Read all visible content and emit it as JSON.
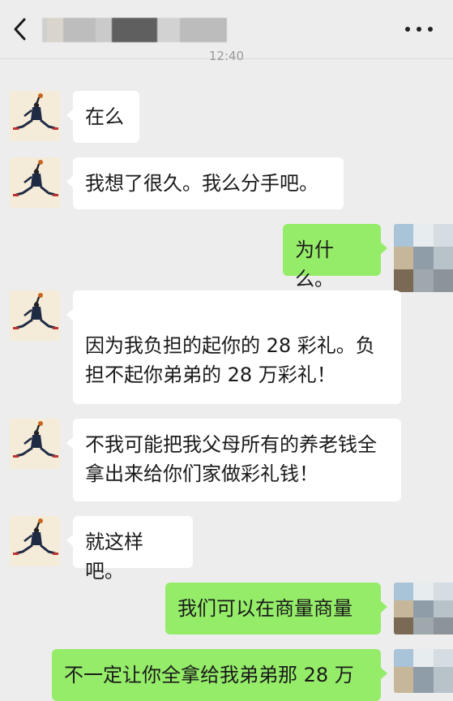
{
  "header": {
    "back_icon": "chevron-left-icon",
    "more_icon": "ellipsis-icon",
    "contact_name_blurred": true
  },
  "timestamp": "12:40",
  "messages": [
    {
      "side": "left",
      "text": "在么"
    },
    {
      "side": "left",
      "text": "我想了很久。我么分手吧。"
    },
    {
      "side": "right",
      "text": "为什么。"
    },
    {
      "side": "left",
      "text": "因为我负担的起你的 28 彩礼。负担不起你弟弟的 28 万彩礼！"
    },
    {
      "side": "left",
      "text": "不我可能把我父母所有的养老钱全拿出来给你们家做彩礼钱！"
    },
    {
      "side": "left",
      "text": "就这样吧。"
    },
    {
      "side": "right",
      "text": "我们可以在商量商量"
    },
    {
      "side": "right",
      "text": "不一定让你全拿给我弟弟那 28 万"
    }
  ],
  "colors": {
    "background": "#ededed",
    "bubble_left": "#ffffff",
    "bubble_right": "#95ec69"
  }
}
